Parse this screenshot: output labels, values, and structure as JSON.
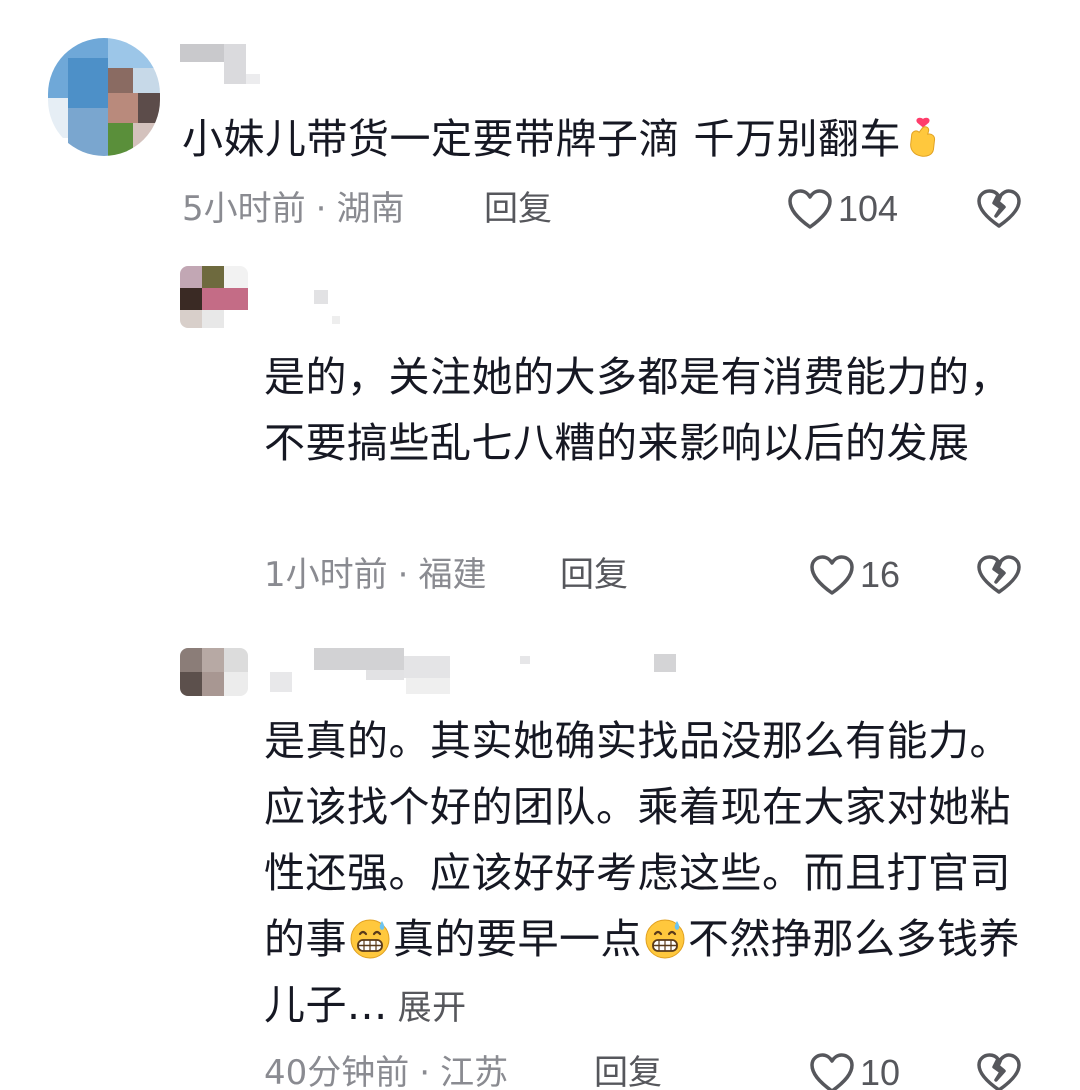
{
  "comments": [
    {
      "text": "小妹儿带货一定要带牌子滴 千万别翻车",
      "emoji": "finger-heart-emoji",
      "time": "5小时前",
      "location": "湖南",
      "reply_label": "回复",
      "likes": "104"
    },
    {
      "text": "是的，关注她的大多都是有消费能力的，不要搞些乱七八糟的来影响以后的发展",
      "time": "1小时前",
      "location": "福建",
      "reply_label": "回复",
      "likes": "16"
    },
    {
      "text_part1": "是真的。其实她确实找品没那么有能力。应该找个好的团队。乘着现在大家对她粘性还强。应该好好考虑这些。而且打官司的事",
      "text_part2": "真的要早一点",
      "text_part3": "不然挣那么多钱养儿子...",
      "emoji": "grin-sweat-emoji",
      "expand_label": "展开",
      "time": "40分钟前",
      "location": "江苏",
      "reply_label": "回复",
      "likes": "10"
    }
  ],
  "meta_separator": "·",
  "colors": {
    "text": "#161823",
    "secondary": "#8a8b91",
    "action": "#56575c"
  }
}
